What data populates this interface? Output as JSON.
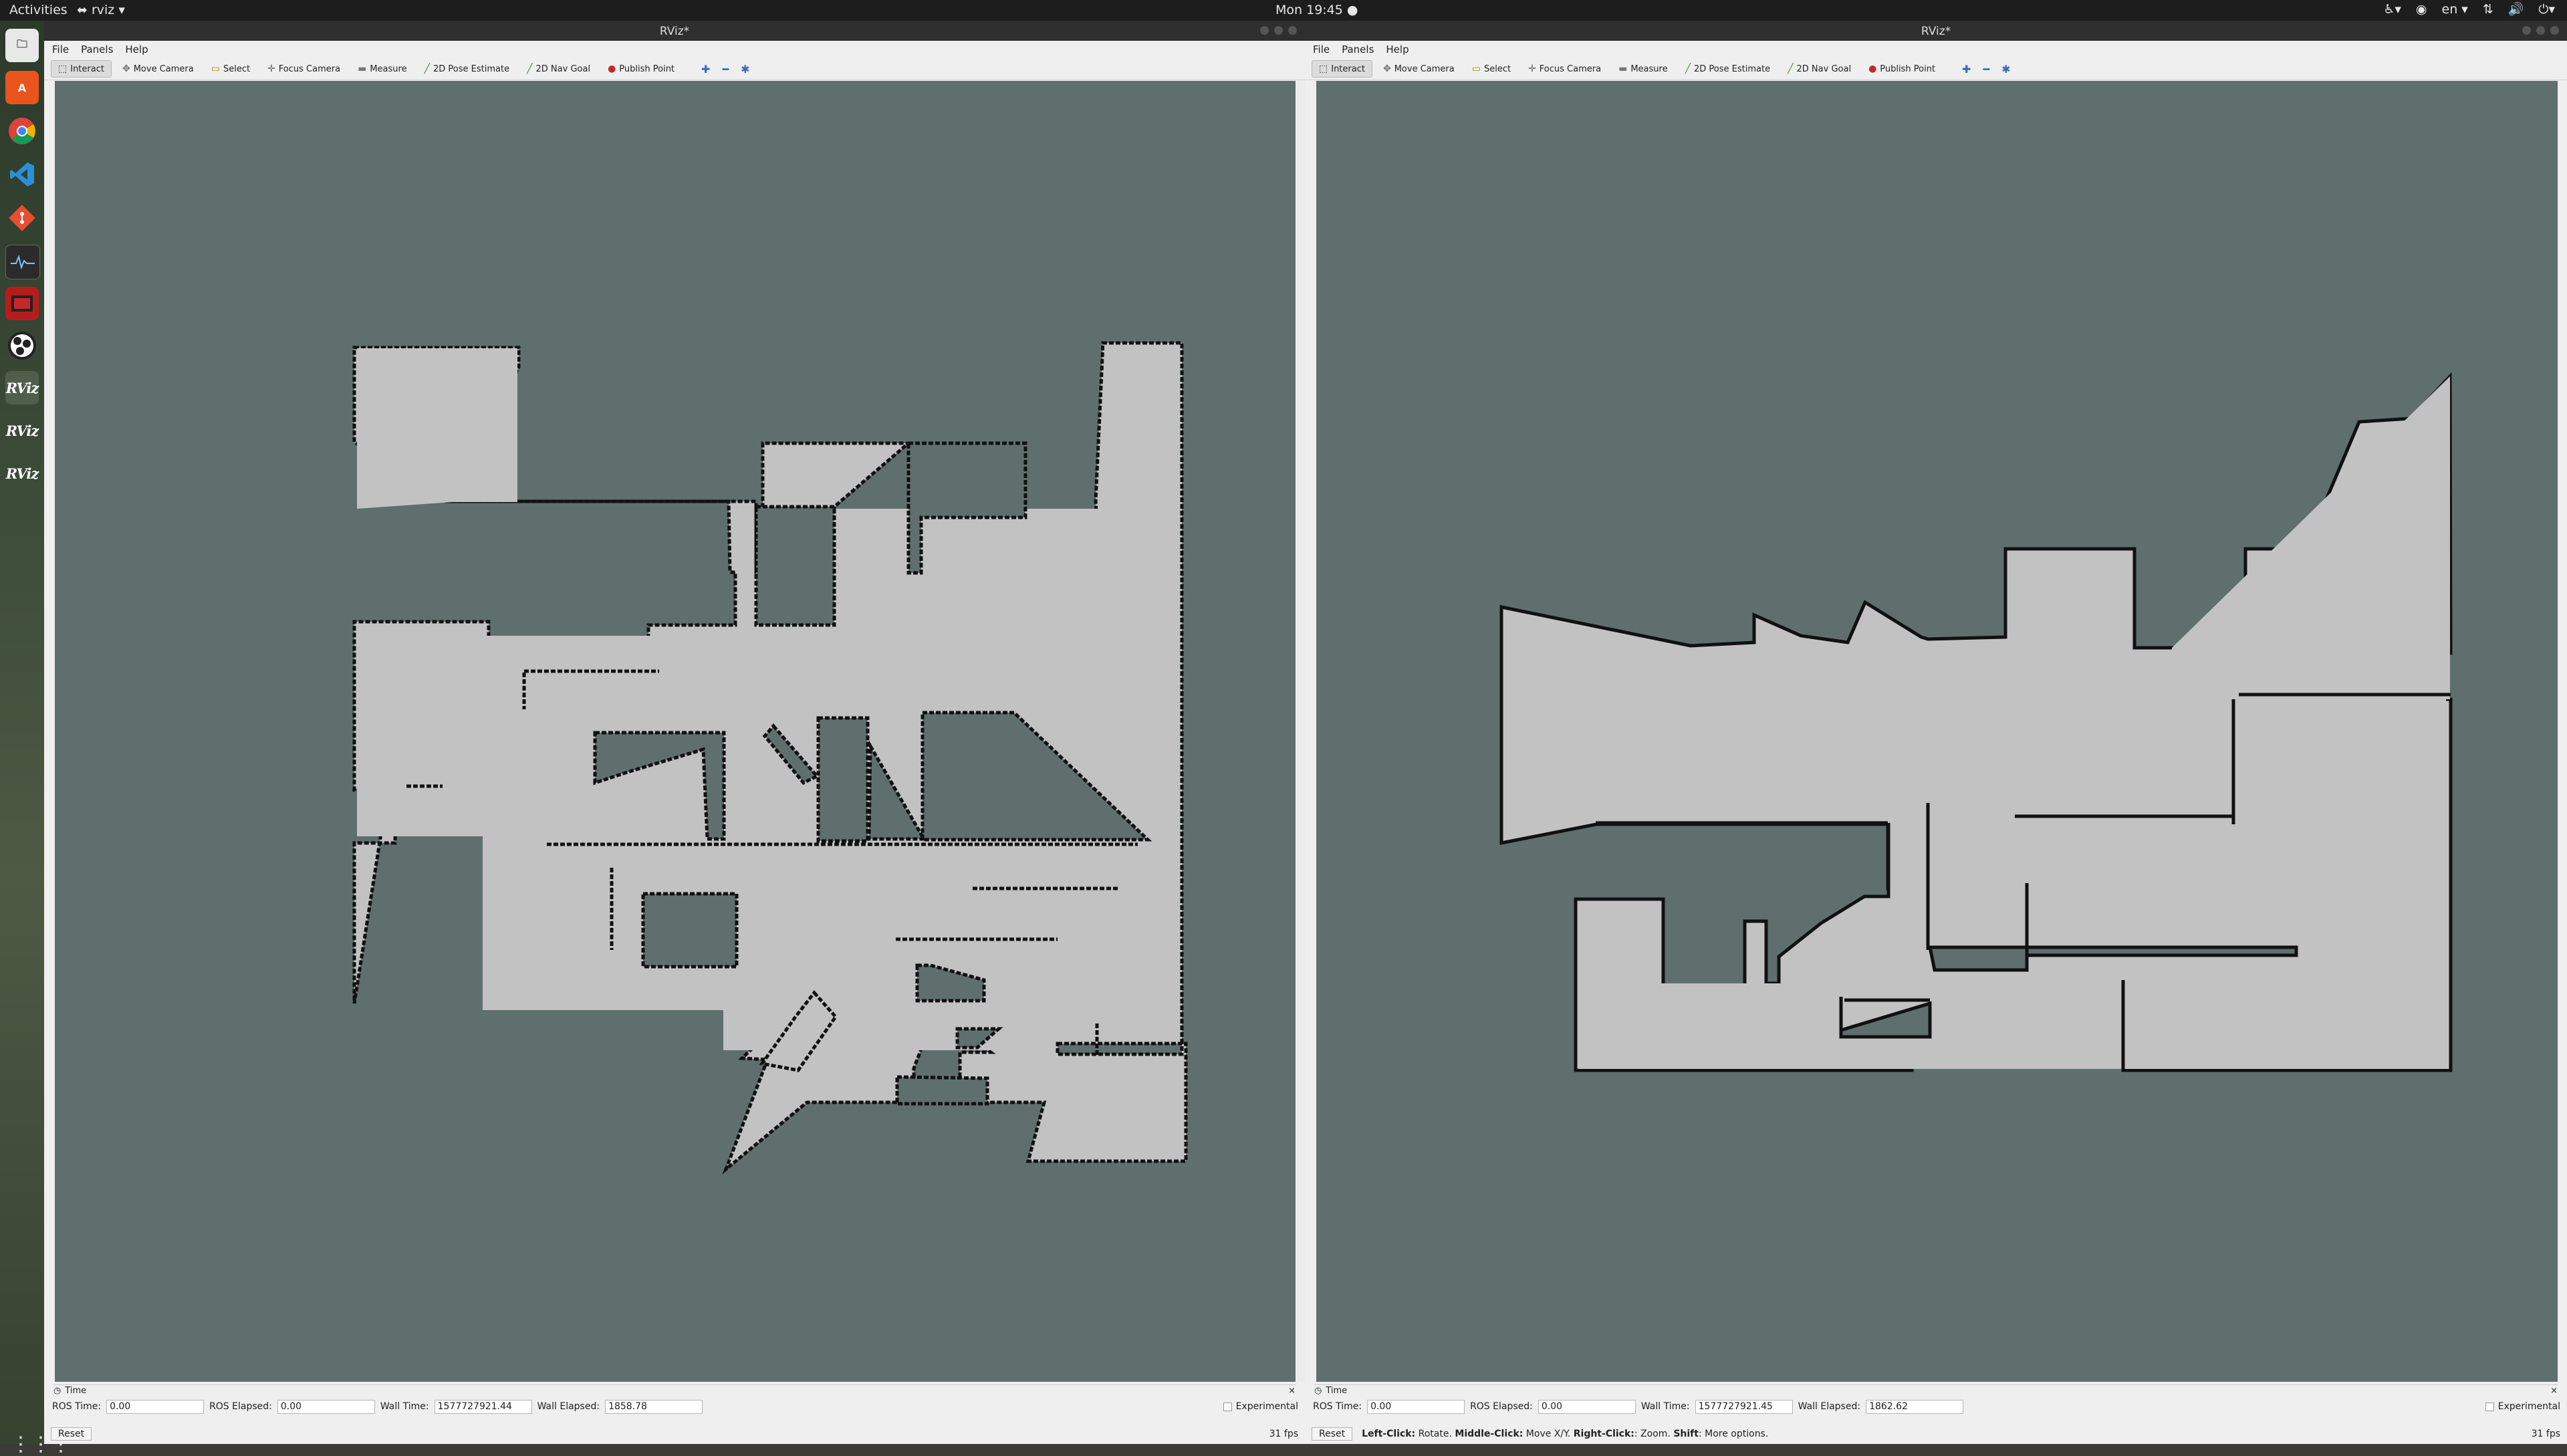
{
  "topbar": {
    "activities": "Activities",
    "app": "rviz ▾",
    "clock": "Mon 19:45 ●",
    "lang": "en ▾"
  },
  "dock": {
    "rviz_label": "RViz"
  },
  "windows": [
    {
      "title": "RViz*",
      "menu": [
        "File",
        "Panels",
        "Help"
      ],
      "tools": [
        "Interact",
        "Move Camera",
        "Select",
        "Focus Camera",
        "Measure",
        "2D Pose Estimate",
        "2D Nav Goal",
        "Publish Point"
      ],
      "time_panel": {
        "title": "Time",
        "ros_time_label": "ROS Time:",
        "ros_time": "0.00",
        "ros_elapsed_label": "ROS Elapsed:",
        "ros_elapsed": "0.00",
        "wall_time_label": "Wall Time:",
        "wall_time": "1577727921.44",
        "wall_elapsed_label": "Wall Elapsed:",
        "wall_elapsed": "1858.78",
        "experimental": "Experimental"
      },
      "reset": "Reset",
      "status": "",
      "fps": "31 fps"
    },
    {
      "title": "RViz*",
      "menu": [
        "File",
        "Panels",
        "Help"
      ],
      "tools": [
        "Interact",
        "Move Camera",
        "Select",
        "Focus Camera",
        "Measure",
        "2D Pose Estimate",
        "2D Nav Goal",
        "Publish Point"
      ],
      "time_panel": {
        "title": "Time",
        "ros_time_label": "ROS Time:",
        "ros_time": "0.00",
        "ros_elapsed_label": "ROS Elapsed:",
        "ros_elapsed": "0.00",
        "wall_time_label": "Wall Time:",
        "wall_time": "1577727921.45",
        "wall_elapsed_label": "Wall Elapsed:",
        "wall_elapsed": "1862.62",
        "experimental": "Experimental"
      },
      "reset": "Reset",
      "status": {
        "b1": "Left-Click:",
        "t1": " Rotate. ",
        "b2": "Middle-Click:",
        "t2": " Move X/Y. ",
        "b3": "Right-Click:",
        "t3": ": Zoom. ",
        "b4": "Shift",
        "t4": ": More options."
      },
      "fps": "31 fps"
    }
  ],
  "colors": {
    "map_background": "#5f6f6d",
    "free_space": "#c2c2c2",
    "walls": "#111111",
    "panel": "#efefef",
    "topbar": "#1d1d1d"
  }
}
